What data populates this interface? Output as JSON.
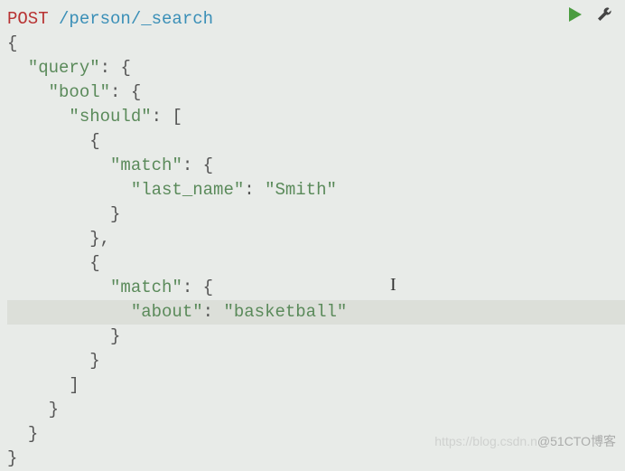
{
  "request": {
    "method": "POST",
    "endpoint": "/person/_search"
  },
  "code": {
    "l1_open": "{",
    "l2_query": "\"query\"",
    "l2_colon": ": {",
    "l3_bool": "\"bool\"",
    "l3_colon": ": {",
    "l4_should": "\"should\"",
    "l4_colon": ": [",
    "l5_open": "{",
    "l6_match": "\"match\"",
    "l6_colon": ": {",
    "l7_lastname": "\"last_name\"",
    "l7_sep": ": ",
    "l7_val": "\"Smith\"",
    "l8_close": "}",
    "l9_close": "},",
    "l10_open": "{",
    "l11_match": "\"match\"",
    "l11_colon": ": {",
    "l12_about": "\"about\"",
    "l12_sep": ": ",
    "l12_val": "\"basketball\"",
    "l13_close": "}",
    "l14_close": "}",
    "l15_close": "]",
    "l16_close": "}",
    "l17_close": "}",
    "l18_close": "}"
  },
  "watermark": {
    "faded": "https://blog.csdn.n",
    "text": "@51CTO博客"
  }
}
